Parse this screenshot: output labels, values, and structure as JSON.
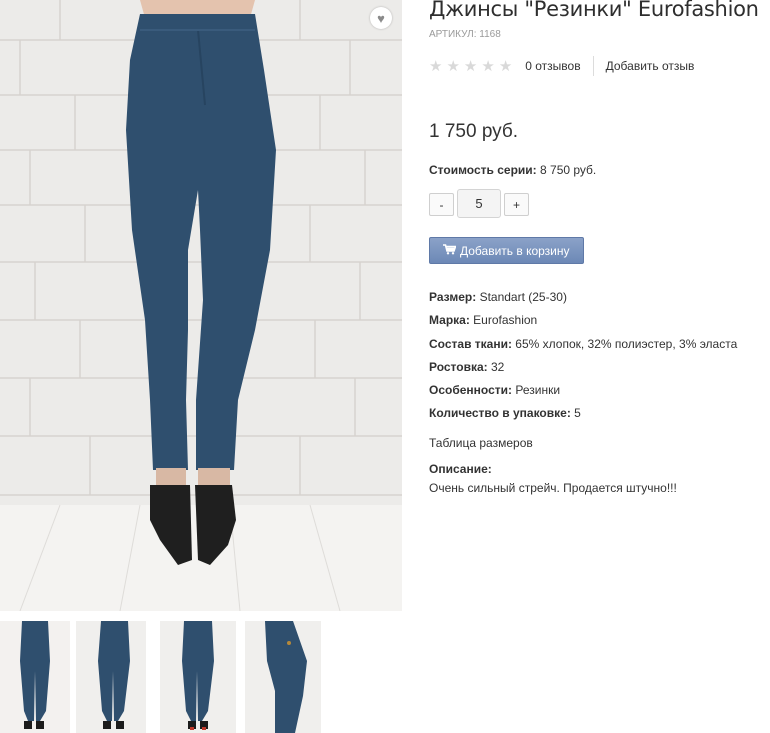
{
  "product": {
    "title": "Джинсы \"Резинки\" Eurofashion",
    "sku": "АРТИКУЛ: 1168",
    "rating": 0,
    "stars_total": 5,
    "reviews": "0 отзывов",
    "add_review": "Добавить отзыв",
    "price": "1 750 руб.",
    "series_label": "Стоимость серии:",
    "series_value": "8 750 руб.",
    "quantity": "5",
    "minus": "-",
    "plus": "+",
    "add_to_cart": "Добавить в корзину",
    "props": [
      {
        "label": "Размер:",
        "value": "Standart (25-30)"
      },
      {
        "label": "Марка:",
        "value": "Eurofashion"
      },
      {
        "label": "Состав ткани:",
        "value": "65% хлопок, 32% полиэстер, 3% эласта"
      },
      {
        "label": "Ростовка:",
        "value": "32"
      },
      {
        "label": "Особенности:",
        "value": "Резинки"
      },
      {
        "label": "Количество в упаковке:",
        "value": "5"
      }
    ],
    "size_table": "Таблица размеров",
    "description_label": "Описание:",
    "description": "Очень сильный стрейч. Продается штучно!!!"
  },
  "icons": {
    "favorite": "heart-icon",
    "star": "star-icon",
    "cart": "cart-icon"
  },
  "colors": {
    "denim": "#2f4f6e",
    "button": "#7892bd",
    "star_empty": "#d9d9d9"
  }
}
